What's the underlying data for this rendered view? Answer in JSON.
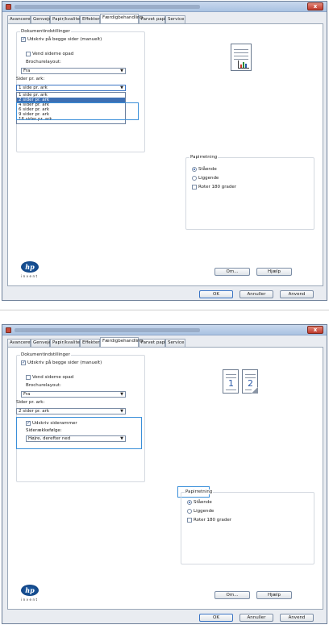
{
  "window_title": "Udskriftsindstillinger for HP LaserJet Professional CP5220 Series PCL 6",
  "close_label": "x",
  "tabs": [
    "Avanceret",
    "Genveje",
    "Papir/kvalitet",
    "Effekter",
    "Færdigbehandling",
    "Farvet papir",
    "Service"
  ],
  "active_tab": "Færdigbehandling",
  "doc_options": {
    "group_label": "Dokumentindstillinger",
    "duplex_label": "Udskriv på begge sider (manuelt)",
    "flip_label": "Vend siderne opad",
    "brochure_label": "Brochurelayout:",
    "brochure_value": "Fra",
    "pages_per_sheet_label": "Sider pr. ark:"
  },
  "screen1": {
    "pages_per_sheet_value": "1 side pr. ark",
    "options": [
      "1 side pr. ark",
      "2 sider pr. ark",
      "4 sider pr. ark",
      "6 sider pr. ark",
      "9 sider pr. ark",
      "16 sider pr. ark"
    ],
    "selected_option": "2 sider pr. ark"
  },
  "screen2": {
    "pages_per_sheet_value": "2 sider pr. ark",
    "page_borders_label": "Udskriv siderammer",
    "page_order_label": "Siderækkefølge:",
    "page_order_value": "Højre, derefter ned",
    "preview_numbers": [
      "1",
      "2"
    ]
  },
  "orientation": {
    "group_label": "Papirretning",
    "portrait_label": "Stående",
    "landscape_label": "Liggende",
    "rotate_label": "Roter 180 grader"
  },
  "buttons": {
    "about": "Om...",
    "help": "Hjælp",
    "ok": "OK",
    "cancel": "Annuller",
    "apply": "Anvend"
  },
  "logo": {
    "text": "hp",
    "tagline": "invent"
  },
  "colors": {
    "highlight": "#3a8fd9",
    "selection": "#3d6fb3"
  }
}
